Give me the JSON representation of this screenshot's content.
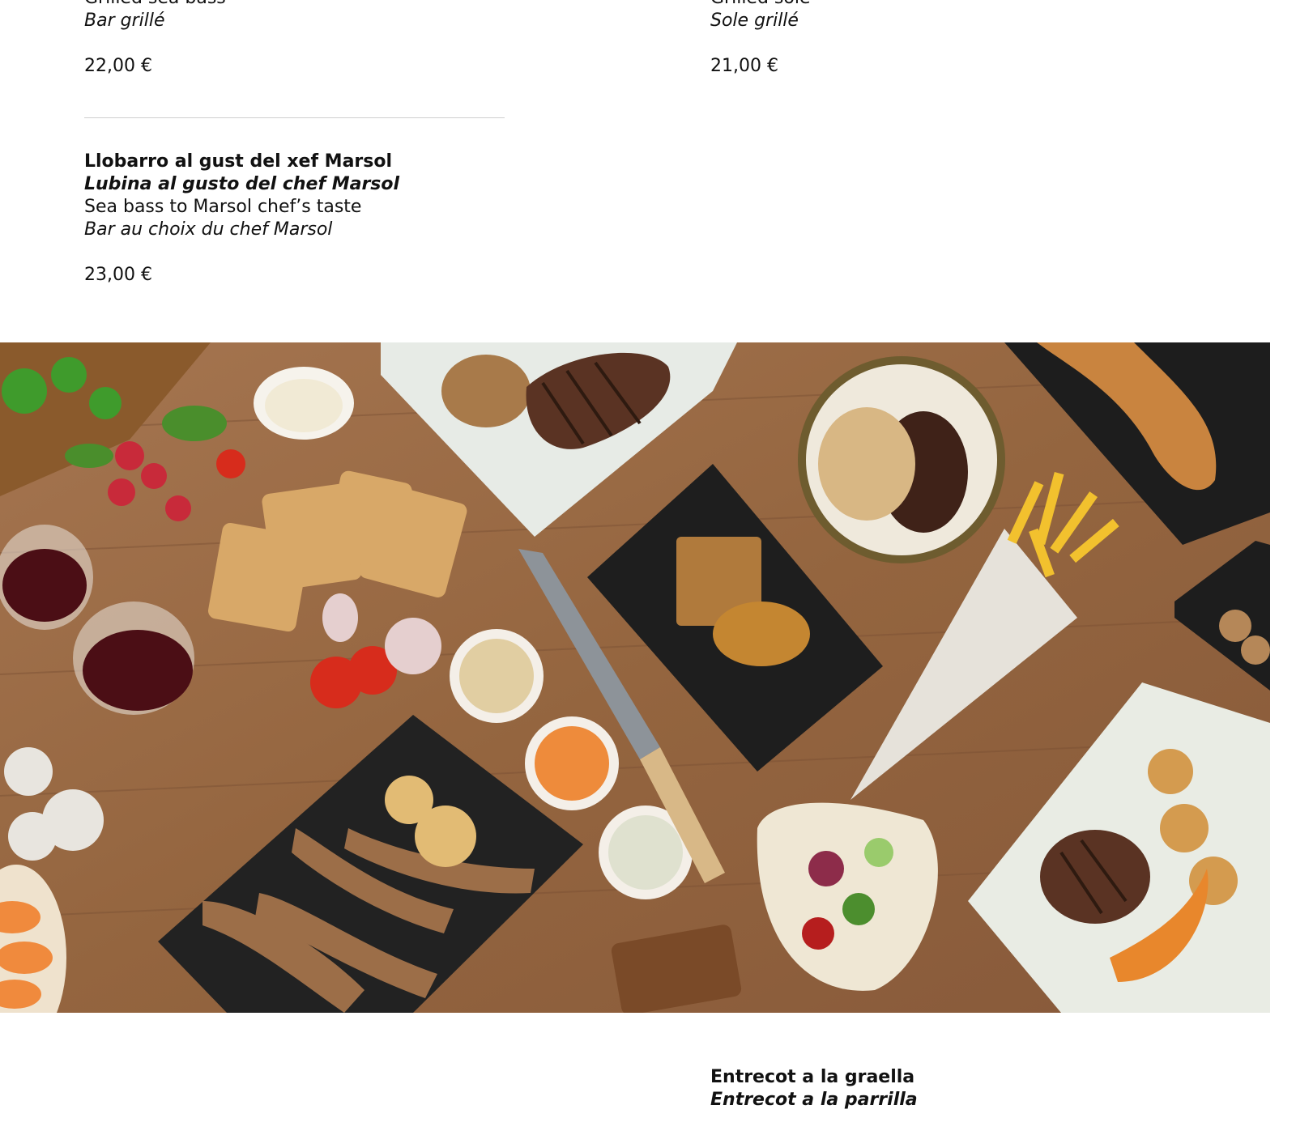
{
  "menu_items": {
    "grilled_sea_bass": {
      "line_en": "Grilled sea bass",
      "line_fr": "Bar grillé",
      "price": "22,00 €"
    },
    "grilled_sole": {
      "line_en": "Grilled sole",
      "line_fr": "Sole grillé",
      "price": "21,00 €"
    },
    "sea_bass_marsol": {
      "line_ca": "Llobarro al gust del xef Marsol",
      "line_es": "Lubina al gusto del chef Marsol",
      "line_en": "Sea bass to Marsol chef’s taste",
      "line_fr": "Bar au choix du chef Marsol",
      "price": "23,00 €"
    },
    "entrecot": {
      "line_ca": "Entrecot a la graella",
      "line_es": "Entrecot a la parrilla"
    }
  },
  "photo": {
    "description_icon": "food-spread-photo",
    "colors": {
      "wood": "#9a6b44",
      "wood_dark": "#7c5234",
      "slate": "#1e1e1e",
      "plate": "#eeeae2",
      "meat": "#5a3323",
      "fries": "#f2c12e",
      "sauce": "#e8872c"
    }
  }
}
